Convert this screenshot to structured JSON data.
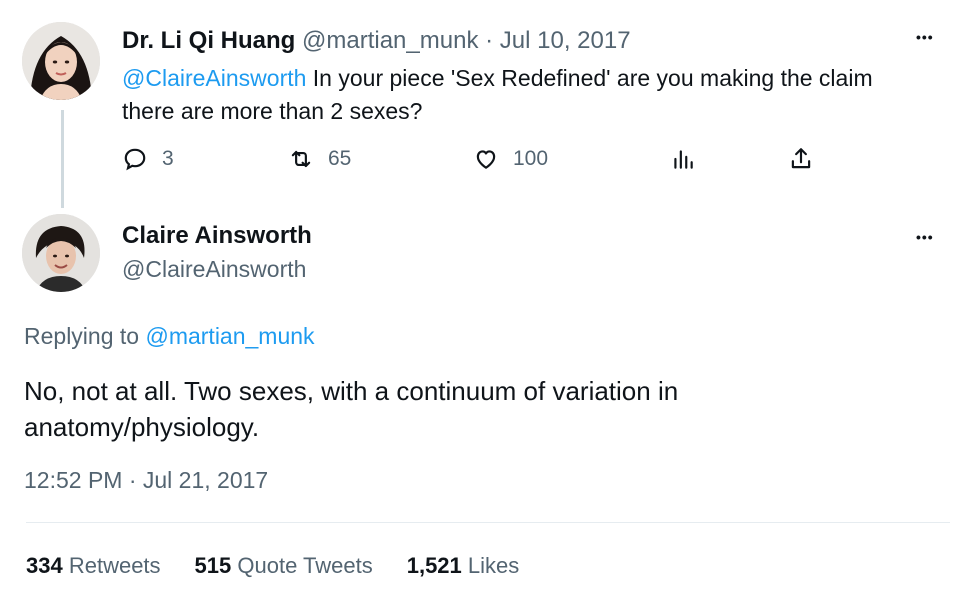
{
  "tweet1": {
    "name": "Dr. Li Qi Huang",
    "handle": "@martian_munk",
    "separator": "·",
    "date": "Jul 10, 2017",
    "mention": "@ClaireAinsworth",
    "text_line1": " In your piece 'Sex Redefined' are you making the claim",
    "text_line2": "there are more than 2 sexes?",
    "more": "•••",
    "actions": {
      "replies": "3",
      "retweets": "65",
      "likes": "100"
    }
  },
  "tweet2": {
    "name": "Claire Ainsworth",
    "handle": "@ClaireAinsworth",
    "more": "•••",
    "replying_prefix": "Replying to ",
    "replying_to": "@martian_munk",
    "text_line1": "No, not at all. Two sexes, with a continuum of variation in",
    "text_line2": "anatomy/physiology.",
    "timestamp": "12:52 PM · Jul 21, 2017"
  },
  "stats": {
    "retweets_count": "334",
    "retweets_label": " Retweets",
    "quotes_count": "515",
    "quotes_label": " Quote Tweets",
    "likes_count": "1,521",
    "likes_label": " Likes"
  },
  "colors": {
    "link": "#1d9bf0",
    "muted": "#536471",
    "text": "#0f1419"
  },
  "icons": [
    "reply-icon",
    "retweet-icon",
    "like-icon",
    "views-icon",
    "share-icon",
    "more-icon"
  ]
}
